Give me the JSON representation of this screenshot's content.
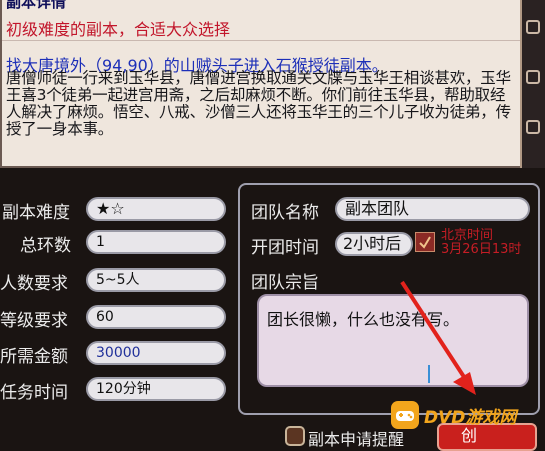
{
  "desc": {
    "title": "副本详情",
    "difficulty_line": "初级难度的副本，合适大众选择",
    "goto_line": "找大唐境外（94,90）的山贼头子进入石猴授徒副本。",
    "body": "唐僧师徒一行来到玉华县，唐僧进宫换取通关文牒与玉华王相谈甚欢，玉华王喜3个徒弟一起进宫用斋，之后却麻烦不断。你们前往玉华县，帮助取经人解决了麻烦。悟空、八戒、沙僧三人还将玉华王的三个儿子收为徒弟，传授了一身本事。"
  },
  "form": {
    "difficulty_label": "副本难度",
    "difficulty_value": "★☆",
    "rounds_label": "总环数",
    "rounds_value": "1",
    "people_label": "人数要求",
    "people_value": "5~5人",
    "level_label": "等级要求",
    "level_value": "60",
    "money_label": "所需金额",
    "money_value": "30000",
    "time_label": "任务时间",
    "time_value": "120分钟"
  },
  "team": {
    "name_label": "团队名称",
    "name_value": "副本团队",
    "start_label": "开团时间",
    "start_value": "2小时后",
    "beijing_label": "北京时间",
    "beijing_value": "3月26日13时",
    "motto_label": "团队宗旨",
    "motto_value": "团长很懒，什么也没有写。"
  },
  "footer": {
    "reminder_label": "副本申请提醒",
    "create_label": "创",
    "watermark": "DVD游戏网"
  },
  "colors": {
    "accent_red": "#c9201d",
    "link_blue": "#1d2fb8"
  }
}
